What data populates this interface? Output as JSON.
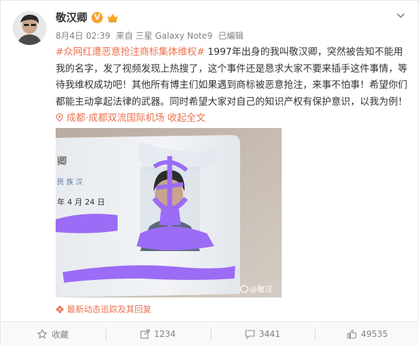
{
  "user": {
    "name": "敬汉卿",
    "verified_badge": "V"
  },
  "post": {
    "meta_date": "8月4日 02:39",
    "meta_source": "来自 三星 Galaxy Note9",
    "meta_edited": "已编辑",
    "hashtag": "#众网红遭恶意抢注商标集体维权#",
    "body": " 1997年出身的我叫敬汉卿，突然被告知不能用我的名字，发了视频发现上热搜了，这个事件还是恳求大家不要来插手这件事情，等待我维权成功吧！其他所有博主们如果遇到商标被恶意抢注，来事不怕事！希望你们都能主动拿起法律的武器。同时希望大家对自己的知识产权有保护意识，以我为例！",
    "location": "成都·成都双流国际机场",
    "expand": "收起全文",
    "image": {
      "card_text_1": "卿",
      "card_text_2": "民 族 汉",
      "card_text_3": "年  4 月 24 日",
      "watermark": "@敬汉"
    },
    "update_link": "最新动态追踪及其回复"
  },
  "actions": {
    "favorite": "收藏",
    "share": "1234",
    "comment": "3441",
    "like": "49535"
  },
  "colors": {
    "accent": "#eb7350",
    "scribble": "#9b6cf5"
  }
}
